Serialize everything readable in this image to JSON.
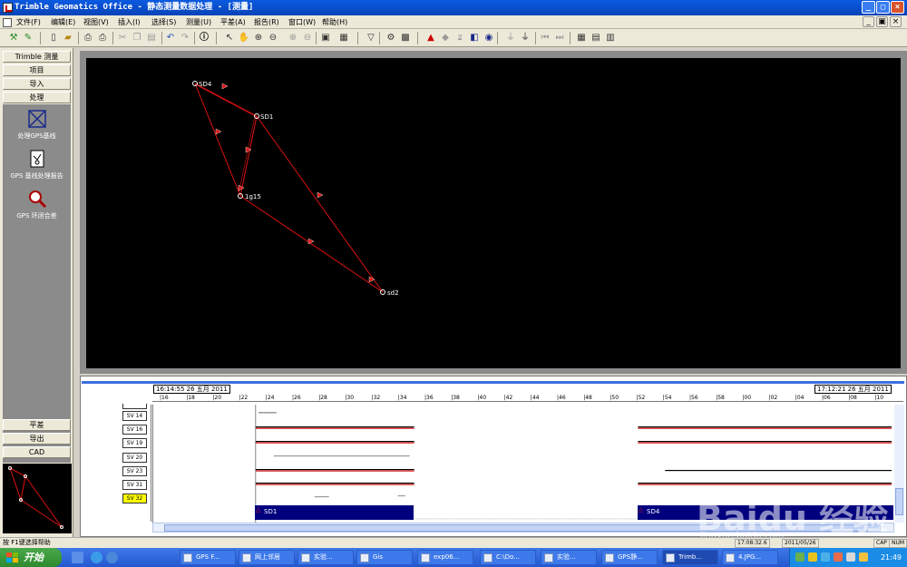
{
  "window": {
    "title": "Trimble Geomatics Office - 静态测量数据处理 - [测量]",
    "controls": {
      "minimize": "_",
      "restore": "▢",
      "close": "×"
    },
    "child_controls": {
      "minimize": "_",
      "restore": "▣",
      "close": "×"
    }
  },
  "menu": [
    {
      "label": "文件(F)"
    },
    {
      "label": "编辑(E)"
    },
    {
      "label": "视图(V)"
    },
    {
      "label": "插入(I)"
    },
    {
      "label": "选择(S)"
    },
    {
      "label": "测量(U)"
    },
    {
      "label": "平差(A)"
    },
    {
      "label": "报告(R)"
    },
    {
      "label": "窗口(W)"
    },
    {
      "label": "帮助(H)"
    }
  ],
  "sidebar": {
    "top_buttons": [
      {
        "label": "Trimble 测量"
      },
      {
        "label": "项目"
      },
      {
        "label": "导入"
      },
      {
        "label": "处理"
      }
    ],
    "tools": [
      {
        "label": "处理GPS基线",
        "icon": "baseline-network-icon"
      },
      {
        "label": "GPS 基线处理报告",
        "icon": "report-icon"
      },
      {
        "label": "GPS 环闭合差",
        "icon": "loop-closure-icon"
      }
    ],
    "bottom_buttons": [
      {
        "label": "平差"
      },
      {
        "label": "导出"
      },
      {
        "label": "CAD"
      }
    ]
  },
  "map": {
    "background": "#000000",
    "line_color": "#dd1111",
    "points": [
      {
        "name": "SD4"
      },
      {
        "name": "SD1"
      },
      {
        "name": "1g15"
      },
      {
        "name": "sd2"
      }
    ]
  },
  "timeline": {
    "start": "16:14:55 26 五月 2011",
    "end": "17:12:21 26 五月 2011",
    "ticks": [
      "16",
      "18",
      "20",
      "22",
      "24",
      "26",
      "28",
      "30",
      "32",
      "34",
      "36",
      "38",
      "40",
      "42",
      "44",
      "46",
      "48",
      "50",
      "52",
      "54",
      "56",
      "58",
      "00",
      "02",
      "04",
      "06",
      "08",
      "10"
    ],
    "satellites": [
      {
        "label": "SV 14",
        "highlight": false
      },
      {
        "label": "SV 16",
        "highlight": false
      },
      {
        "label": "SV 19",
        "highlight": false
      },
      {
        "label": "SV 20",
        "highlight": false
      },
      {
        "label": "SV 23",
        "highlight": false
      },
      {
        "label": "SV 31",
        "highlight": false
      },
      {
        "label": "SV 32",
        "highlight": true
      }
    ],
    "stations": [
      {
        "name": "SD1"
      },
      {
        "name": "SD4"
      }
    ],
    "bar_color": "#00007f"
  },
  "statusbar": {
    "help": "按 F1键选择帮助",
    "coord": "17:08:32.6",
    "date": "2011/05/26",
    "cap": "CAP",
    "num": "NUM"
  },
  "taskbar": {
    "start": "开始",
    "tasks": [
      {
        "label": "GPS F..."
      },
      {
        "label": "网上邻居"
      },
      {
        "label": "实验..."
      },
      {
        "label": "Gis"
      },
      {
        "label": "exp06..."
      },
      {
        "label": "C:\\Do..."
      },
      {
        "label": "实验..."
      },
      {
        "label": "GPS静..."
      },
      {
        "label": "Trimb..."
      },
      {
        "label": "4.JPG..."
      }
    ],
    "clock": "21:49"
  },
  "watermark": {
    "text": "Baidu 经验",
    "url": "jingyan.baidu.com"
  }
}
